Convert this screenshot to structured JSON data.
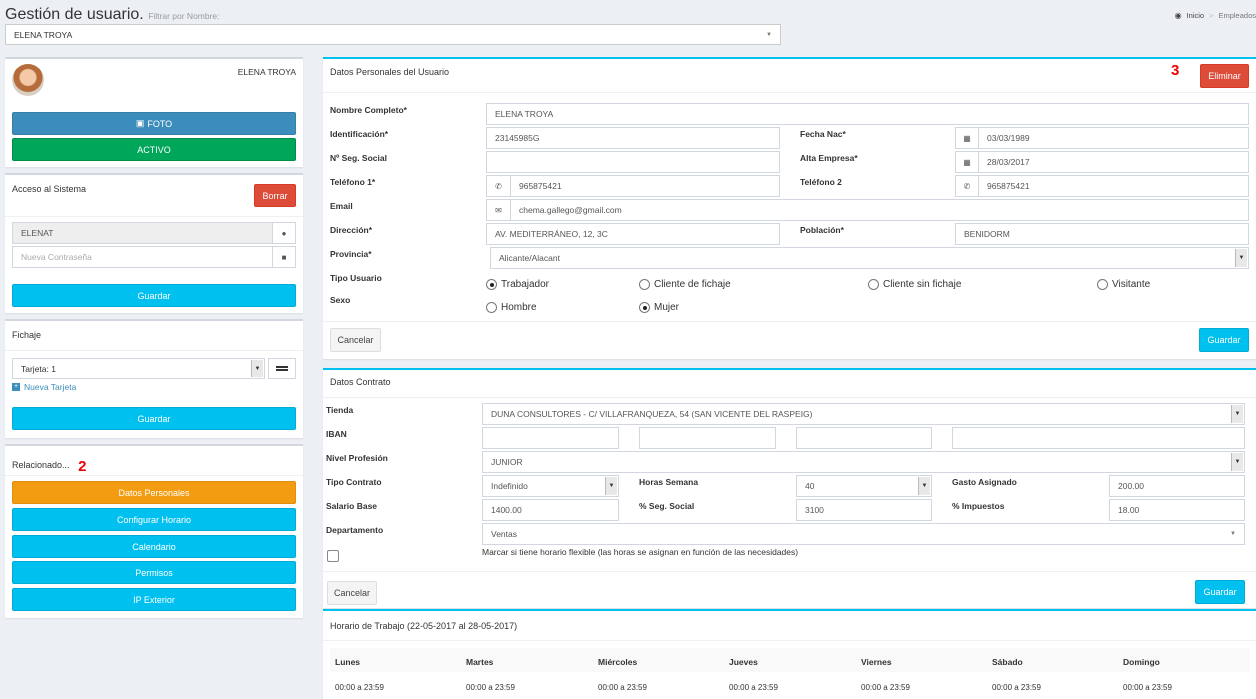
{
  "header": {
    "title": "Gestión de usuario.",
    "filter_label": "Filtrar por Nombre:",
    "selected_user": "ELENA TROYA",
    "breadcrumb": [
      "Inicio",
      ">",
      "Empleados"
    ]
  },
  "profile": {
    "name": "ELENA TROYA",
    "photo_btn": "FOTO",
    "status_btn": "ACTIVO"
  },
  "access": {
    "title": "Acceso al Sistema",
    "delete_btn": "Borrar",
    "username": "ELENAT",
    "password_placeholder": "Nueva Contraseña",
    "save_btn": "Guardar"
  },
  "fichaje": {
    "title": "Fichaje",
    "card": "Tarjeta: 1",
    "new_card": "Nueva Tarjeta",
    "save_btn": "Guardar"
  },
  "related": {
    "title": "Relacionado...",
    "marker": "2",
    "items": [
      "Datos Personales",
      "Configurar Horario",
      "Calendario",
      "Permisos",
      "IP Exterior"
    ]
  },
  "personal": {
    "title": "Datos Personales del Usuario",
    "marker": "3",
    "delete_btn": "Eliminar",
    "labels": {
      "full_name": "Nombre Completo*",
      "id": "Identificación*",
      "birth": "Fecha Nac*",
      "ss": "Nº Seg. Social",
      "hire": "Alta Empresa*",
      "phone1": "Teléfono 1*",
      "phone2": "Teléfono 2",
      "email": "Email",
      "address": "Dirección*",
      "city": "Población*",
      "province": "Provincia*",
      "user_type": "Tipo Usuario",
      "sex": "Sexo"
    },
    "values": {
      "full_name": "ELENA TROYA",
      "id": "23145985G",
      "birth": "03/03/1989",
      "ss": "",
      "hire": "28/03/2017",
      "phone1": "965875421",
      "phone2": "965875421",
      "email": "chema.gallego@gmail.com",
      "address": "AV. MEDITERRÁNEO, 12, 3C",
      "city": "BENIDORM",
      "province": "Alicante/Alacant"
    },
    "user_types": [
      "Trabajador",
      "Cliente de fichaje",
      "Cliente sin fichaje",
      "Visitante"
    ],
    "sexes": [
      "Hombre",
      "Mujer"
    ],
    "cancel_btn": "Cancelar",
    "save_btn": "Guardar"
  },
  "contract": {
    "title": "Datos Contrato",
    "labels": {
      "store": "Tienda",
      "iban": "IBAN",
      "level": "Nivel Profesión",
      "type": "Tipo Contrato",
      "hours": "Horas Semana",
      "expense": "Gasto Asignado",
      "salary": "Salario Base",
      "ss_pct": "% Seg. Social",
      "tax_pct": "% Impuestos",
      "dept": "Departamento"
    },
    "values": {
      "store": "DUNA CONSULTORES - C/ VILLAFRANQUEZA, 54 (SAN VICENTE DEL RASPEIG)",
      "level": "JUNIOR",
      "type": "Indefinido",
      "hours": "40",
      "expense": "200.00",
      "salary": "1400.00",
      "ss_pct": "3100",
      "tax_pct": "18.00",
      "dept": "Ventas"
    },
    "flex_text": "Marcar si tiene horario flexible (las horas se asignan en función de las necesidades)",
    "cancel_btn": "Cancelar",
    "save_btn": "Guardar"
  },
  "schedule": {
    "title": "Horario de Trabajo (22-05-2017 al 28-05-2017)",
    "days": [
      "Lunes",
      "Martes",
      "Miércoles",
      "Jueves",
      "Viernes",
      "Sábado",
      "Domingo"
    ],
    "hours": [
      "00:00 a 23:59",
      "00:00 a 23:59",
      "00:00 a 23:59",
      "00:00 a 23:59",
      "00:00 a 23:59",
      "00:00 a 23:59",
      "00:00 a 23:59"
    ]
  },
  "colors": {
    "primary": "#3c8dbc",
    "success": "#00a65a",
    "info": "#00c0ef",
    "warning": "#f39c12",
    "danger": "#dd4b39"
  }
}
